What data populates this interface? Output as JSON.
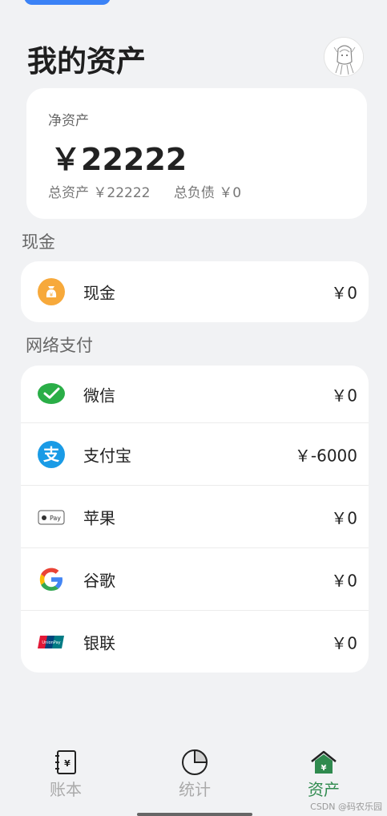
{
  "header": {
    "title": "我的资产"
  },
  "net_assets": {
    "label": "净资产",
    "value": "￥22222",
    "total_assets": "总资产 ￥22222",
    "total_liabilities": "总负债 ￥0"
  },
  "sections": {
    "cash": {
      "title": "现金",
      "items": [
        {
          "name": "现金",
          "amount": "￥0",
          "icon": "money-bag-icon"
        }
      ]
    },
    "online": {
      "title": "网络支付",
      "items": [
        {
          "name": "微信",
          "amount": "￥0",
          "icon": "wechat-icon"
        },
        {
          "name": "支付宝",
          "amount": "￥-6000",
          "icon": "alipay-icon"
        },
        {
          "name": "苹果",
          "amount": "￥0",
          "icon": "apple-pay-icon"
        },
        {
          "name": "谷歌",
          "amount": "￥0",
          "icon": "google-icon"
        },
        {
          "name": "银联",
          "amount": "￥0",
          "icon": "unionpay-icon"
        }
      ]
    }
  },
  "bottom_nav": {
    "tabs": [
      {
        "label": "账本",
        "icon": "ledger-icon",
        "active": false
      },
      {
        "label": "统计",
        "icon": "pie-chart-icon",
        "active": false
      },
      {
        "label": "资产",
        "icon": "assets-home-icon",
        "active": true
      }
    ]
  },
  "watermark": "CSDN @码农乐园"
}
